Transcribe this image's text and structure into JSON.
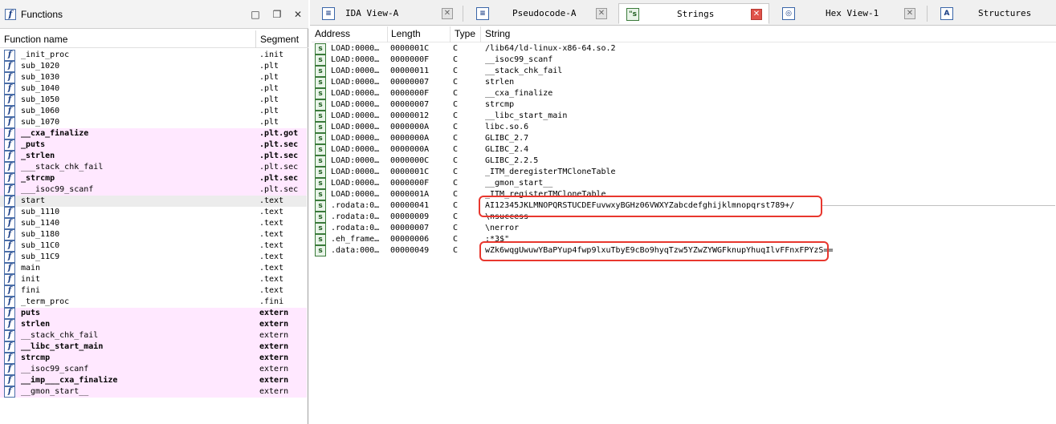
{
  "functions_pane": {
    "title": "Functions",
    "header": {
      "name": "Function name",
      "segment": "Segment"
    },
    "items": [
      {
        "name": "_init_proc",
        "segment": ".init",
        "style": "normal"
      },
      {
        "name": "sub_1020",
        "segment": ".plt",
        "style": "normal"
      },
      {
        "name": "sub_1030",
        "segment": ".plt",
        "style": "normal"
      },
      {
        "name": "sub_1040",
        "segment": ".plt",
        "style": "normal"
      },
      {
        "name": "sub_1050",
        "segment": ".plt",
        "style": "normal"
      },
      {
        "name": "sub_1060",
        "segment": ".plt",
        "style": "normal"
      },
      {
        "name": "sub_1070",
        "segment": ".plt",
        "style": "normal"
      },
      {
        "name": "__cxa_finalize",
        "segment": ".plt.got",
        "style": "pink-bold"
      },
      {
        "name": "_puts",
        "segment": ".plt.sec",
        "style": "pink-bold"
      },
      {
        "name": "_strlen",
        "segment": ".plt.sec",
        "style": "pink-bold"
      },
      {
        "name": "___stack_chk_fail",
        "segment": ".plt.sec",
        "style": "pink"
      },
      {
        "name": "_strcmp",
        "segment": ".plt.sec",
        "style": "pink-bold"
      },
      {
        "name": "___isoc99_scanf",
        "segment": ".plt.sec",
        "style": "pink"
      },
      {
        "name": "start",
        "segment": ".text",
        "style": "selected"
      },
      {
        "name": "sub_1110",
        "segment": ".text",
        "style": "normal"
      },
      {
        "name": "sub_1140",
        "segment": ".text",
        "style": "normal"
      },
      {
        "name": "sub_1180",
        "segment": ".text",
        "style": "normal"
      },
      {
        "name": "sub_11C0",
        "segment": ".text",
        "style": "normal"
      },
      {
        "name": "sub_11C9",
        "segment": ".text",
        "style": "normal"
      },
      {
        "name": "main",
        "segment": ".text",
        "style": "normal"
      },
      {
        "name": "init",
        "segment": ".text",
        "style": "normal"
      },
      {
        "name": "fini",
        "segment": ".text",
        "style": "normal"
      },
      {
        "name": "_term_proc",
        "segment": ".fini",
        "style": "normal"
      },
      {
        "name": "puts",
        "segment": "extern",
        "style": "pink-bold"
      },
      {
        "name": "strlen",
        "segment": "extern",
        "style": "pink-bold"
      },
      {
        "name": "__stack_chk_fail",
        "segment": "extern",
        "style": "pink"
      },
      {
        "name": "__libc_start_main",
        "segment": "extern",
        "style": "pink-bold"
      },
      {
        "name": "strcmp",
        "segment": "extern",
        "style": "pink-bold"
      },
      {
        "name": "__isoc99_scanf",
        "segment": "extern",
        "style": "pink"
      },
      {
        "name": "__imp___cxa_finalize",
        "segment": "extern",
        "style": "pink-bold"
      },
      {
        "name": "__gmon_start__",
        "segment": "extern",
        "style": "pink"
      }
    ]
  },
  "tabs": [
    {
      "label": "IDA View-A",
      "icon": "disassembly-icon",
      "active": false
    },
    {
      "label": "Pseudocode-A",
      "icon": "pseudocode-icon",
      "active": false
    },
    {
      "label": "Strings",
      "icon": "strings-icon",
      "active": true
    },
    {
      "label": "Hex View-1",
      "icon": "hex-view-icon",
      "active": false
    },
    {
      "label": "Structures",
      "icon": "structures-icon",
      "active": false
    }
  ],
  "strings_view": {
    "header": {
      "address": "Address",
      "length": "Length",
      "type": "Type",
      "string": "String"
    },
    "rows": [
      {
        "address": "LOAD:0000…",
        "length": "0000001C",
        "type": "C",
        "string": "/lib64/ld-linux-x86-64.so.2"
      },
      {
        "address": "LOAD:0000…",
        "length": "0000000F",
        "type": "C",
        "string": "__isoc99_scanf"
      },
      {
        "address": "LOAD:0000…",
        "length": "00000011",
        "type": "C",
        "string": "__stack_chk_fail"
      },
      {
        "address": "LOAD:0000…",
        "length": "00000007",
        "type": "C",
        "string": "strlen"
      },
      {
        "address": "LOAD:0000…",
        "length": "0000000F",
        "type": "C",
        "string": "__cxa_finalize"
      },
      {
        "address": "LOAD:0000…",
        "length": "00000007",
        "type": "C",
        "string": "strcmp"
      },
      {
        "address": "LOAD:0000…",
        "length": "00000012",
        "type": "C",
        "string": "__libc_start_main"
      },
      {
        "address": "LOAD:0000…",
        "length": "0000000A",
        "type": "C",
        "string": "libc.so.6"
      },
      {
        "address": "LOAD:0000…",
        "length": "0000000A",
        "type": "C",
        "string": "GLIBC_2.7"
      },
      {
        "address": "LOAD:0000…",
        "length": "0000000A",
        "type": "C",
        "string": "GLIBC_2.4"
      },
      {
        "address": "LOAD:0000…",
        "length": "0000000C",
        "type": "C",
        "string": "GLIBC_2.2.5"
      },
      {
        "address": "LOAD:0000…",
        "length": "0000001C",
        "type": "C",
        "string": "_ITM_deregisterTMCloneTable"
      },
      {
        "address": "LOAD:0000…",
        "length": "0000000F",
        "type": "C",
        "string": "__gmon_start__"
      },
      {
        "address": "LOAD:0000…",
        "length": "0000001A",
        "type": "C",
        "string": "_ITM_registerTMCloneTable"
      },
      {
        "address": ".rodata:0…",
        "length": "00000041",
        "type": "C",
        "string": "AI12345JKLMNOPQRSTUCDEFuvwxyBGHz06VWXYZabcdefghijklmnopqrst789+/"
      },
      {
        "address": ".rodata:0…",
        "length": "00000009",
        "type": "C",
        "string": "\\nsuccess"
      },
      {
        "address": ".rodata:0…",
        "length": "00000007",
        "type": "C",
        "string": "\\nerror"
      },
      {
        "address": ".eh_frame…",
        "length": "00000006",
        "type": "C",
        "string": ";*3$\""
      },
      {
        "address": ".data:000…",
        "length": "00000049",
        "type": "C",
        "string": "wZk6wqgUwuwYBaPYup4fwp9lxuTbyE9cBo9hyqTzw5YZwZYWGFknupYhuqIlvFFnxFPYzS=="
      }
    ]
  },
  "colors": {
    "highlight_border": "#e8372e",
    "imported_row": "#ffe8ff",
    "active_tab_close": "#e0524a"
  }
}
